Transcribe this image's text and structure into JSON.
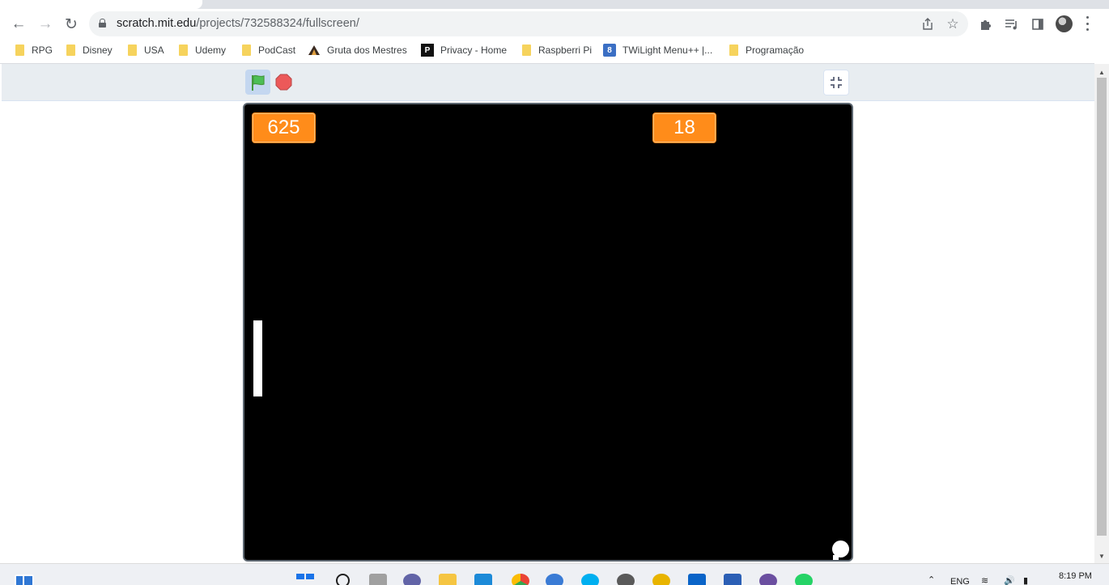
{
  "browser": {
    "url_host": "scratch.mit.edu",
    "url_path": "/projects/732588324/fullscreen/",
    "bookmarks": [
      {
        "label": "RPG",
        "icon": "folder-icon"
      },
      {
        "label": "Disney",
        "icon": "folder-icon"
      },
      {
        "label": "USA",
        "icon": "folder-icon"
      },
      {
        "label": "Udemy",
        "icon": "folder-icon"
      },
      {
        "label": "PodCast",
        "icon": "folder-icon"
      },
      {
        "label": "Gruta dos Mestres",
        "icon": "gruta-favicon"
      },
      {
        "label": "Privacy - Home",
        "icon": "p-favicon"
      },
      {
        "label": "Raspberri Pi",
        "icon": "folder-icon"
      },
      {
        "label": "TWiLight Menu++ |...",
        "icon": "twilight-favicon"
      },
      {
        "label": "Programação",
        "icon": "folder-icon"
      }
    ]
  },
  "player": {
    "score_left": "625",
    "score_right": "18",
    "flag_color": "#4cbf56",
    "stop_color": "#ec5959",
    "score_color": "#ff8c1a"
  },
  "taskbar": {
    "lang": "ENG",
    "time": "8:19 PM"
  }
}
